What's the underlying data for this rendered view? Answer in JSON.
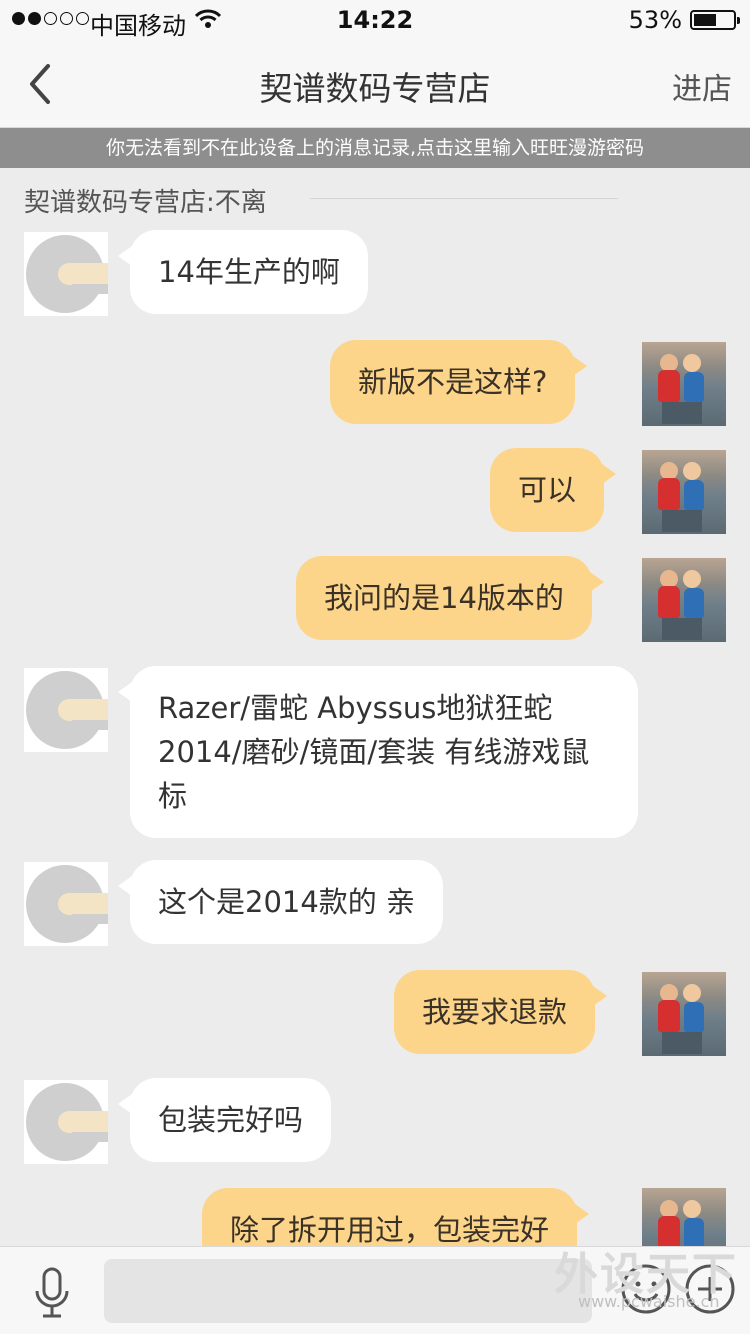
{
  "status_bar": {
    "carrier": "中国移动",
    "time": "14:22",
    "battery": "53%"
  },
  "nav": {
    "title": "契谱数码专营店",
    "enter_shop": "进店"
  },
  "notice": "你无法看到不在此设备上的消息记录,点击这里输入旺旺漫游密码",
  "divider_title": "契谱数码专营店:不离",
  "messages": [
    {
      "from": "shop",
      "text": "14年生产的啊"
    },
    {
      "from": "me",
      "text": "新版不是这样?"
    },
    {
      "from": "me",
      "text": "可以"
    },
    {
      "from": "me",
      "text": "我问的是14版本的"
    },
    {
      "from": "shop",
      "lines": [
        "Razer/雷蛇 Abyssus地狱狂蛇",
        "2014/磨砂/镜面/套装 有线游戏鼠",
        "标"
      ]
    },
    {
      "from": "shop",
      "text": "这个是2014款的 亲"
    },
    {
      "from": "me",
      "text": "我要求退款"
    },
    {
      "from": "shop",
      "text": "包装完好吗"
    },
    {
      "from": "me",
      "text": "除了拆开用过，包装完好"
    }
  ],
  "watermark": {
    "title": "外设天下",
    "url": "www.pcwaishe.cn"
  },
  "icons": [
    "back-chevron-icon",
    "wifi-icon",
    "battery-icon",
    "microphone-icon",
    "emoji-icon",
    "plus-icon"
  ]
}
